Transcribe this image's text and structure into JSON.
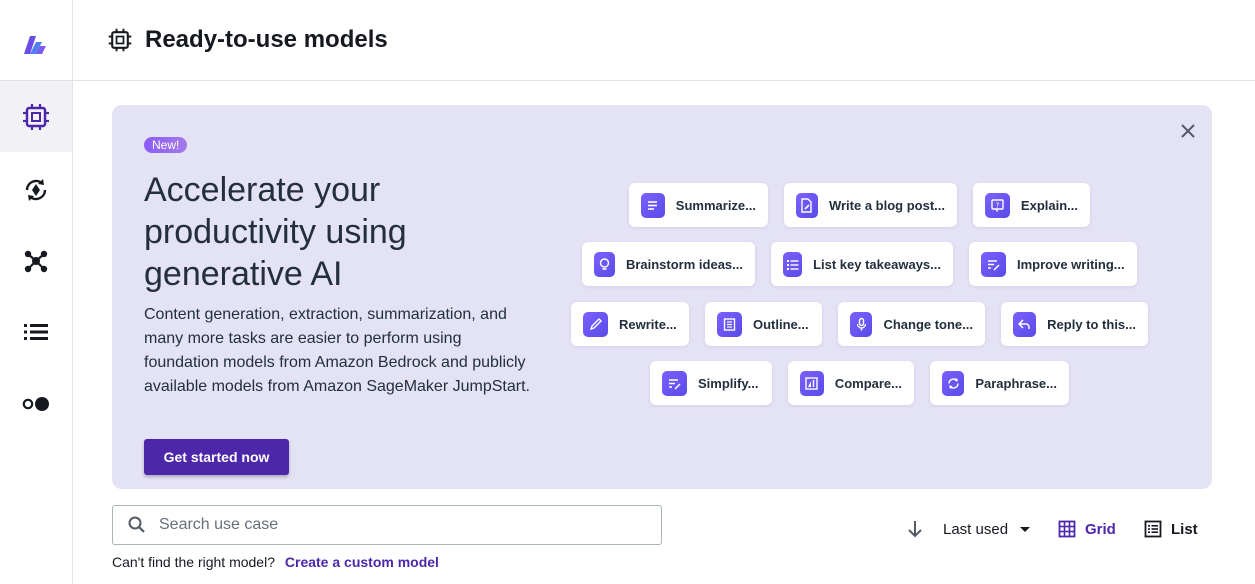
{
  "header": {
    "title": "Ready-to-use models"
  },
  "banner": {
    "badge": "New!",
    "heading": "Accelerate your productivity using generative AI",
    "body": "Content generation, extraction, summarization, and many more tasks are easier to perform using foundation models from Amazon Bedrock and publicly available models from Amazon SageMaker JumpStart.",
    "cta": "Get started now",
    "chips": [
      "Summarize...",
      "Write a blog post...",
      "Explain...",
      "Brainstorm ideas...",
      "List key takeaways...",
      "Improve writing...",
      "Rewrite...",
      "Outline...",
      "Change tone...",
      "Reply to this...",
      "Simplify...",
      "Compare...",
      "Paraphrase..."
    ]
  },
  "search": {
    "placeholder": "Search use case"
  },
  "toolbar": {
    "sort_label": "Last used",
    "grid_label": "Grid",
    "list_label": "List"
  },
  "footer": {
    "helper_text": "Can't find the right model?",
    "link": "Create a custom model"
  },
  "icons": {
    "sidebar": [
      "canvas-logo-icon",
      "chip-icon",
      "refresh-target-icon",
      "network-icon",
      "list-icon",
      "toggle-icon"
    ],
    "chips": [
      "document-lines-icon",
      "document-pen-icon",
      "question-icon",
      "lightbulb-icon",
      "bullet-list-icon",
      "edit-lines-icon",
      "pencil-icon",
      "outline-icon",
      "microphone-icon",
      "reply-icon",
      "simplify-icon",
      "compare-icon",
      "cycle-icon"
    ]
  },
  "colors": {
    "accent": "#4d27aa",
    "banner_bg": "#e4e2f5",
    "chip_icon": "#6a55f0"
  }
}
